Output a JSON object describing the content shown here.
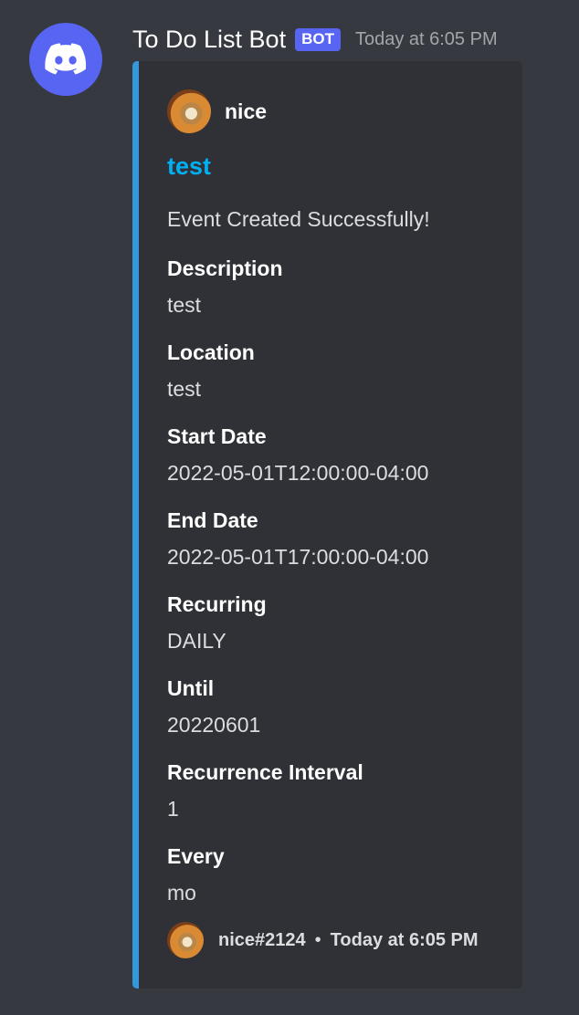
{
  "message": {
    "avatar_icon": "discord-logo-icon",
    "avatar_color": "#5865f2",
    "username": "To Do List Bot",
    "bot_tag": "BOT",
    "timestamp": "Today at 6:05 PM"
  },
  "embed": {
    "accent_color": "#3498db",
    "author": {
      "name": "nice",
      "avatar_icon": "user-avatar-icon"
    },
    "title": "test",
    "title_color": "#00aff4",
    "description": "Event Created Successfully!",
    "fields": [
      {
        "name": "Description",
        "value": "test"
      },
      {
        "name": "Location",
        "value": "test"
      },
      {
        "name": "Start Date",
        "value": "2022-05-01T12:00:00-04:00"
      },
      {
        "name": "End Date",
        "value": "2022-05-01T17:00:00-04:00"
      },
      {
        "name": "Recurring",
        "value": "DAILY"
      },
      {
        "name": "Until",
        "value": "20220601"
      },
      {
        "name": "Recurrence Interval",
        "value": "1"
      },
      {
        "name": "Every",
        "value": "mo"
      }
    ],
    "footer": {
      "text": "nice#2124",
      "separator": "•",
      "timestamp": "Today at 6:05 PM",
      "avatar_icon": "user-avatar-icon"
    }
  }
}
